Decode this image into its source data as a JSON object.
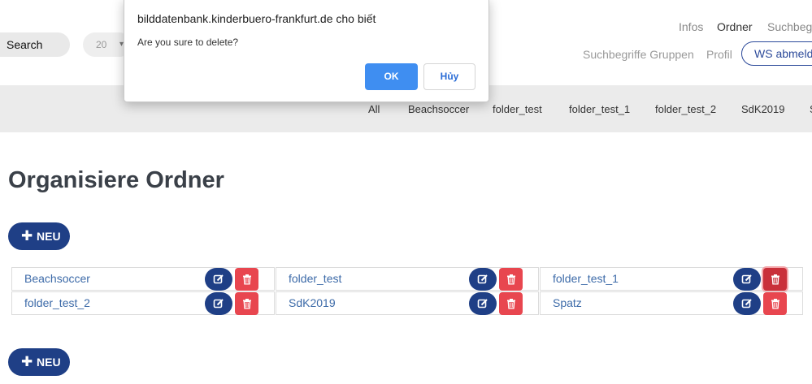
{
  "header": {
    "search_label": "Search",
    "per_page_value": "20",
    "top_nav": [
      "Infos",
      "Ordner",
      "Suchbegr"
    ],
    "sub_nav": [
      "Suchbegriffe Gruppen",
      "Profil"
    ],
    "ws_button": "WS abmelde"
  },
  "folder_bar": {
    "tabs": [
      "All",
      "Beachsoccer",
      "folder_test",
      "folder_test_1",
      "folder_test_2",
      "SdK2019",
      "S"
    ]
  },
  "main": {
    "title": "Organisiere Ordner",
    "new_button_label": "NEU",
    "folders": [
      "Beachsoccer",
      "folder_test",
      "folder_test_1",
      "folder_test_2",
      "SdK2019",
      "Spatz"
    ]
  },
  "dialog": {
    "origin": "bilddatenbank.kinderbuero-frankfurt.de cho biết",
    "message": "Are you sure to delete?",
    "ok_label": "OK",
    "cancel_label": "Hủy"
  },
  "colors": {
    "primary": "#1f3f86",
    "danger": "#e8464f",
    "link": "#3c6aa8",
    "dialog_ok": "#3f8ef1"
  },
  "icons": {
    "new": "plus-icon",
    "edit": "edit-icon",
    "delete": "trash-icon",
    "select": "chevron-down-icon"
  }
}
